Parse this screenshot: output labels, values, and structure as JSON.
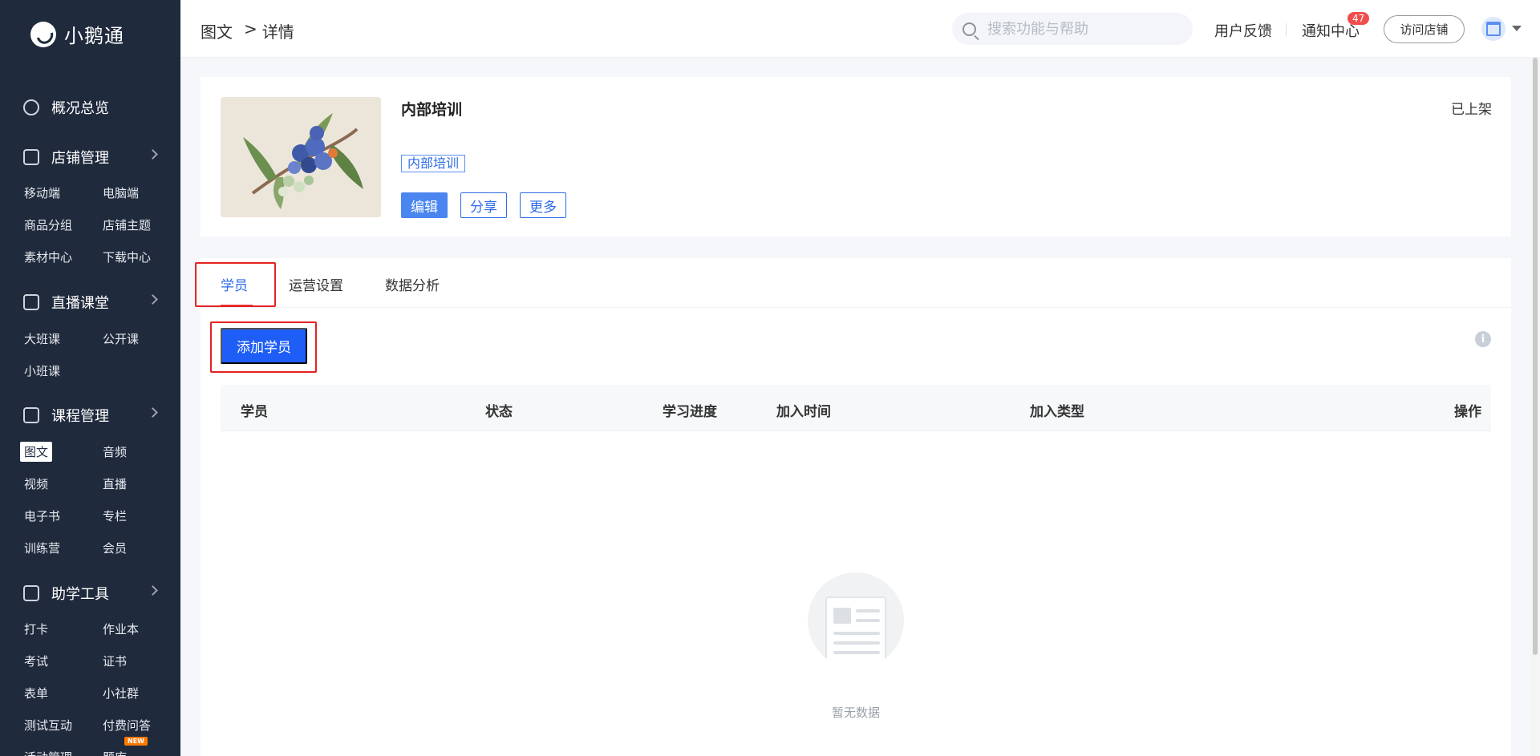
{
  "app": {
    "brand": "小鹅通"
  },
  "sidebar": {
    "sections": [
      {
        "label": "概况总览",
        "icon": "pie-chart-icon",
        "has_arrow": false,
        "items": []
      },
      {
        "label": "店铺管理",
        "icon": "store-icon",
        "has_arrow": true,
        "items": [
          "移动端",
          "电脑端",
          "商品分组",
          "店铺主题",
          "素材中心",
          "下载中心"
        ]
      },
      {
        "label": "直播课堂",
        "icon": "video-camera-icon",
        "has_arrow": true,
        "items": [
          "大班课",
          "公开课",
          "小班课"
        ]
      },
      {
        "label": "课程管理",
        "icon": "document-icon",
        "has_arrow": true,
        "items": [
          "图文",
          "音频",
          "视频",
          "直播",
          "电子书",
          "专栏",
          "训练营",
          "会员"
        ]
      },
      {
        "label": "助学工具",
        "icon": "toolbox-icon",
        "has_arrow": true,
        "items": [
          "打卡",
          "作业本",
          "考试",
          "证书",
          "表单",
          "小社群",
          "测试互动",
          "付费问答",
          "活动管理",
          "题库"
        ]
      }
    ],
    "active_item": "图文",
    "new_badge": "NEW"
  },
  "header": {
    "breadcrumb": [
      "图文",
      ">",
      "详情"
    ],
    "search_placeholder": "搜索功能与帮助",
    "feedback": "用户反馈",
    "notifications": "通知中心",
    "notification_count": "47",
    "visit_store": "访问店铺"
  },
  "product": {
    "title": "内部培训",
    "tag": "内部培训",
    "status": "已上架",
    "actions": [
      "编辑",
      "分享",
      "更多"
    ]
  },
  "tabs": [
    "学员",
    "运营设置",
    "数据分析"
  ],
  "active_tab": "学员",
  "add_button": "添加学员",
  "table": {
    "columns": [
      "学员",
      "状态",
      "学习进度",
      "加入时间",
      "加入类型",
      "操作"
    ],
    "rows": []
  },
  "empty_text": "暂无数据",
  "colors": {
    "sidebar_bg": "#1f2a3c",
    "primary": "#1f5ef6",
    "highlight": "#e52222"
  }
}
